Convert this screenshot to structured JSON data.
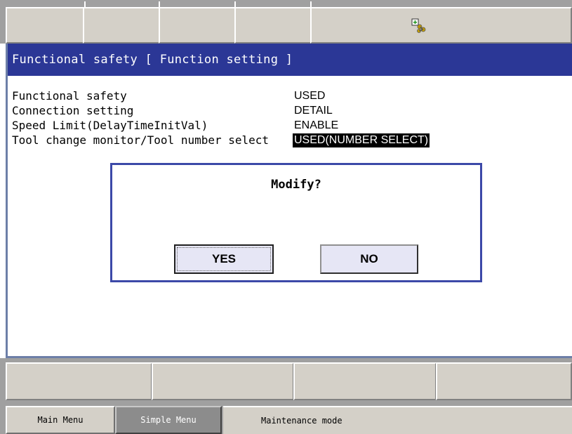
{
  "top_icon": "robot-jog-icon",
  "window": {
    "title": "Functional safety [ Function setting ]"
  },
  "settings": [
    {
      "label": "Functional safety",
      "value": "USED"
    },
    {
      "label": "Connection setting",
      "value": "DETAIL"
    },
    {
      "label": "Speed Limit(DelayTimeInitVal)",
      "value": "ENABLE"
    },
    {
      "label": "Tool change monitor/Tool number select",
      "value": "USED(NUMBER SELECT)"
    }
  ],
  "dialog": {
    "title": "Modify?",
    "yes_label": "YES",
    "no_label": "NO"
  },
  "status": {
    "main_menu": "Main Menu",
    "simple_menu": "Simple Menu",
    "message": "Maintenance mode"
  },
  "colors": {
    "title_bar": "#2b3796",
    "dialog_border": "#3c49a8",
    "selected_value_bg": "#000000"
  }
}
